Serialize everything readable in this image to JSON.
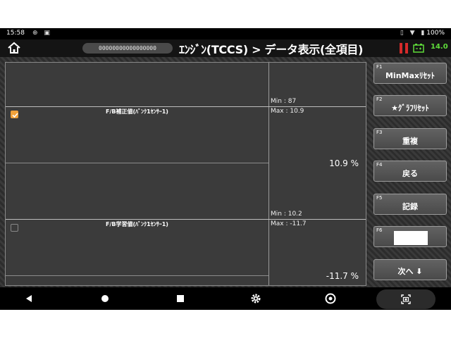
{
  "status_bar": {
    "time": "15:58",
    "battery_percent": "100%"
  },
  "header": {
    "vin": "00000000000000000",
    "title": "ｴﾝｼﾞﾝ(TCCS) > データ表示(全項目)",
    "voltage": "14.0"
  },
  "panel": {
    "top_row": {
      "min_label": "Min :  87"
    },
    "rows": [
      {
        "name": "F/B補正値(ﾊﾞﾝｸ1ｾﾝｻｰ1)",
        "checked": true,
        "max_label": "Max : 10.9",
        "value": "10.9 %",
        "min_label": "Min : 10.2"
      },
      {
        "name": "F/B学習値(ﾊﾞﾝｸ1ｾﾝｻｰ1)",
        "checked": false,
        "max_label": "Max : -11.7",
        "value": "-11.7 %"
      }
    ]
  },
  "function_keys": [
    {
      "key": "F1",
      "label": "MinMaxﾘｾｯﾄ"
    },
    {
      "key": "F2",
      "label": "★ｸﾞﾗﾌﾘｾｯﾄ"
    },
    {
      "key": "F3",
      "label": "重複"
    },
    {
      "key": "F4",
      "label": "戻る"
    },
    {
      "key": "F5",
      "label": "記録"
    },
    {
      "key": "F6",
      "label": ""
    },
    {
      "key": "",
      "label": "次へ ⬇"
    }
  ],
  "colors": {
    "accent_check": "#f0a13a",
    "voltage_green": "#5fdc3a",
    "pause_red": "#d42a2a"
  }
}
